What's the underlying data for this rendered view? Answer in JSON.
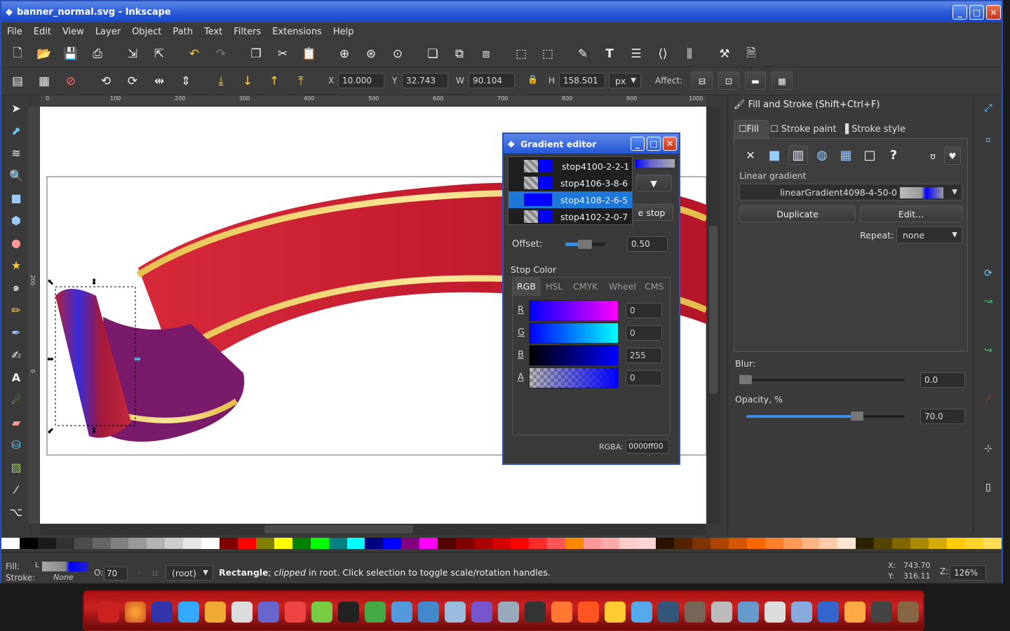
{
  "window": {
    "title": "banner_normal.svg - Inkscape",
    "min": "_",
    "max": "□",
    "close": "✕"
  },
  "menu": [
    "File",
    "Edit",
    "View",
    "Layer",
    "Object",
    "Path",
    "Text",
    "Filters",
    "Extensions",
    "Help"
  ],
  "coords": {
    "x_label": "X",
    "x": "10.000",
    "y_label": "Y",
    "y": "32.743",
    "w_label": "W",
    "w": "90.104",
    "h_label": "H",
    "h": "158.501",
    "unit": "px",
    "affect": "Affect:"
  },
  "ruler": {
    "h": [
      "0",
      "100",
      "200",
      "300",
      "400",
      "500",
      "600",
      "700",
      "800",
      "900",
      "1000"
    ],
    "v": [
      "200",
      "0"
    ]
  },
  "gradient_editor": {
    "title": "Gradient editor",
    "stops": [
      "stop4100-2-2-1",
      "stop4106-3-8-6",
      "stop4108-2-6-5",
      "stop4102-2-0-7"
    ],
    "hidden_btn": "e stop",
    "offset_label": "Offset:",
    "offset": "0.50",
    "offset_fraction": 0.5,
    "stop_color_label": "Stop Color",
    "tabs": [
      "RGB",
      "HSL",
      "CMYK",
      "Wheel",
      "CMS"
    ],
    "channels": [
      {
        "label": "R",
        "value": "0"
      },
      {
        "label": "G",
        "value": "0"
      },
      {
        "label": "B",
        "value": "255"
      },
      {
        "label": "A",
        "value": "0"
      }
    ],
    "rgba_label": "RGBA:",
    "rgba": "0000ff00"
  },
  "fill_panel": {
    "title": "Fill and Stroke (Shift+Ctrl+F)",
    "tabs": [
      "Fill",
      "Stroke paint",
      "Stroke style"
    ],
    "gradient_type": "Linear gradient",
    "gradient_name": "linearGradient4098-4-50-0",
    "duplicate": "Duplicate",
    "edit": "Edit...",
    "repeat_label": "Repeat:",
    "repeat": "none",
    "blur_label": "Blur:",
    "blur": "0.0",
    "blur_fraction": 0.0,
    "opacity_label": "Opacity, %",
    "opacity": "70.0",
    "opacity_fraction": 0.7
  },
  "status": {
    "fill_label": "Fill:",
    "stroke_label": "Stroke:",
    "fill_type": "L",
    "stroke_value": "None",
    "o_label": "O:",
    "o_value": "70",
    "layer": "(root)",
    "message_bold": "Rectangle",
    "message_italic": "clipped",
    "message_rest": " in root. Click selection to toggle scale/rotation handles.",
    "cursor_x_label": "X:",
    "cursor_x": "743.70",
    "cursor_y_label": "Y:",
    "cursor_y": "316.11",
    "zoom_label": "Z:",
    "zoom": "126%"
  },
  "palette": [
    "#fff",
    "#000",
    "#1a1a1a",
    "#333",
    "#4d4d4d",
    "#666",
    "#808080",
    "#999",
    "#b3b3b3",
    "#ccc",
    "#e6e6e6",
    "#fff",
    "#800000",
    "#f00",
    "#808000",
    "#ff0",
    "#008000",
    "#0f0",
    "#008080",
    "#0ff",
    "#000080",
    "#00f",
    "#800080",
    "#f0f",
    "#550000",
    "#800000",
    "#aa0000",
    "#d40000",
    "#f00",
    "#ff2a2a",
    "#f55",
    "#f80",
    "#f99",
    "#faa",
    "#fcc",
    "#ffd5d5",
    "#2b1100",
    "#552200",
    "#803300",
    "#aa4400",
    "#d45500",
    "#f60",
    "#ff7f2a",
    "#f95",
    "#ffb380",
    "#fca",
    "#ffe6d5",
    "#2b2200",
    "#554400",
    "#806600",
    "#aa8800",
    "#d4aa00",
    "#fc0",
    "#ffd42a",
    "#fd5"
  ]
}
